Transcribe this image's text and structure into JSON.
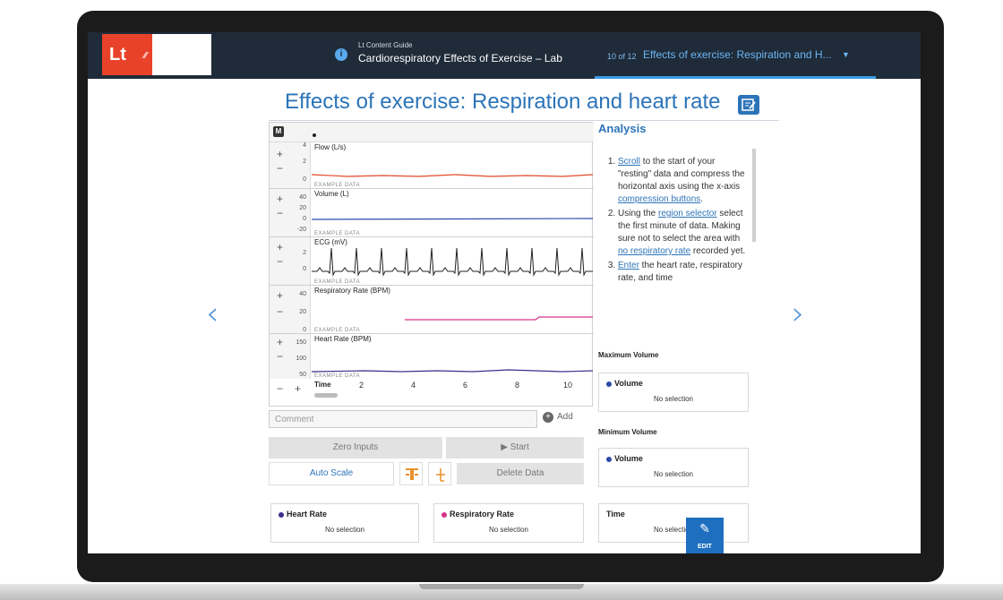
{
  "header": {
    "logo_text": "Lt",
    "guide_small": "Lt Content Guide",
    "guide_title": "Cardiorespiratory Effects of Exercise – Lab",
    "crumb_count": "10 of 12",
    "crumb_text": "Effects of exercise: Respiration and H..."
  },
  "page": {
    "title": "Effects of exercise: Respiration and heart rate"
  },
  "chart": {
    "m_badge": "M",
    "example_label": "EXAMPLE DATA",
    "channels": [
      {
        "name": "Flow (L/s)",
        "ticks": [
          "4",
          "2",
          "0"
        ]
      },
      {
        "name": "Volume (L)",
        "ticks": [
          "40",
          "20",
          "0",
          "-20"
        ]
      },
      {
        "name": "ECG (mV)",
        "ticks": [
          "2",
          "0"
        ]
      },
      {
        "name": "Respiratory Rate (BPM)",
        "ticks": [
          "40",
          "20",
          "0"
        ]
      },
      {
        "name": "Heart Rate (BPM)",
        "ticks": [
          "150",
          "100",
          "50"
        ]
      }
    ],
    "time_label": "Time",
    "time_ticks": [
      "2",
      "4",
      "6",
      "8",
      "10"
    ]
  },
  "controls": {
    "comment_placeholder": "Comment",
    "add_label": "Add",
    "zero_inputs": "Zero Inputs",
    "start": "▶ Start",
    "auto_scale": "Auto Scale",
    "delete_data": "Delete Data"
  },
  "analysis": {
    "title": "Analysis",
    "step1": {
      "link1": "Scroll",
      "t1": " to the start of your \"resting\" data and compress the horizontal axis using the x-axis ",
      "link2": "compression buttons",
      "t2": "."
    },
    "step2": {
      "t0": "Using the ",
      "link1": "region selector",
      "t1": " select the first minute of data. Making sure not to select the area with ",
      "link2": "no respiratory rate",
      "t2": " recorded yet."
    },
    "step3": {
      "link1": "Enter",
      "t1": " the heart rate, respiratory rate, and time"
    }
  },
  "stats": {
    "max_volume_title": "Maximum Volume",
    "min_volume_title": "Minimum Volume",
    "volume_label": "Volume",
    "no_selection": "No selection",
    "heart_rate_label": "Heart Rate",
    "resp_rate_label": "Respiratory Rate",
    "time_label": "Time"
  },
  "fab": {
    "label": "EDIT"
  },
  "colors": {
    "accent": "#2c74b8",
    "logo": "#e8432a",
    "volume_dot": "#2e4aa8",
    "heart_dot": "#3a2f8c",
    "resp_dot": "#d6338a"
  }
}
